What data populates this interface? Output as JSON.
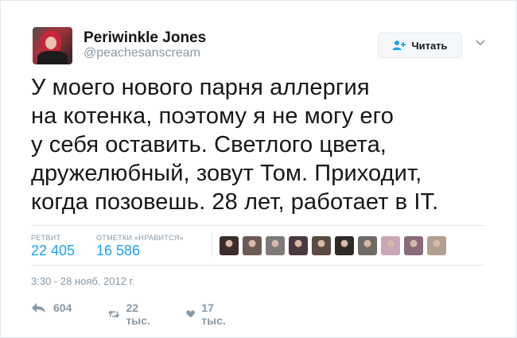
{
  "user": {
    "name": "Periwinkle Jones",
    "handle": "@peachesanscream",
    "avatar_icon": "profile-photo"
  },
  "follow": {
    "label": "Читать",
    "icon": "add-user-icon"
  },
  "menu": {
    "icon": "chevron-down-icon"
  },
  "tweet": {
    "lines": [
      "У моего нового парня аллергия",
      "на котенка, поэтому я не могу его",
      "у себя оставить. Светлого цвета,",
      "дружелюбный, зовут Том. Приходит,",
      "когда позовешь. 28 лет, работает в IT."
    ]
  },
  "stats": {
    "retweets_label": "РЕТВИТ",
    "retweets_value": "22 405",
    "likes_label": "ОТМЕТКИ «НРАВИТСЯ»",
    "likes_value": "16 586"
  },
  "likers": [
    "#3a2d2b",
    "#6b5a55",
    "#7d7a78",
    "#4a3a3f",
    "#5a4a42",
    "#2e2a28",
    "#6f6a66",
    "#c9a7b7",
    "#8a6b7a",
    "#b0a090"
  ],
  "timestamp": "3:30 - 28 нояб. 2012 г.",
  "actions": {
    "reply_count": "604",
    "retweet_count": "22 тыс.",
    "like_count": "17 тыс."
  },
  "colors": {
    "accent": "#1da1f2",
    "muted": "#8899a6",
    "text": "#14171a",
    "border": "#e1e8ed"
  }
}
